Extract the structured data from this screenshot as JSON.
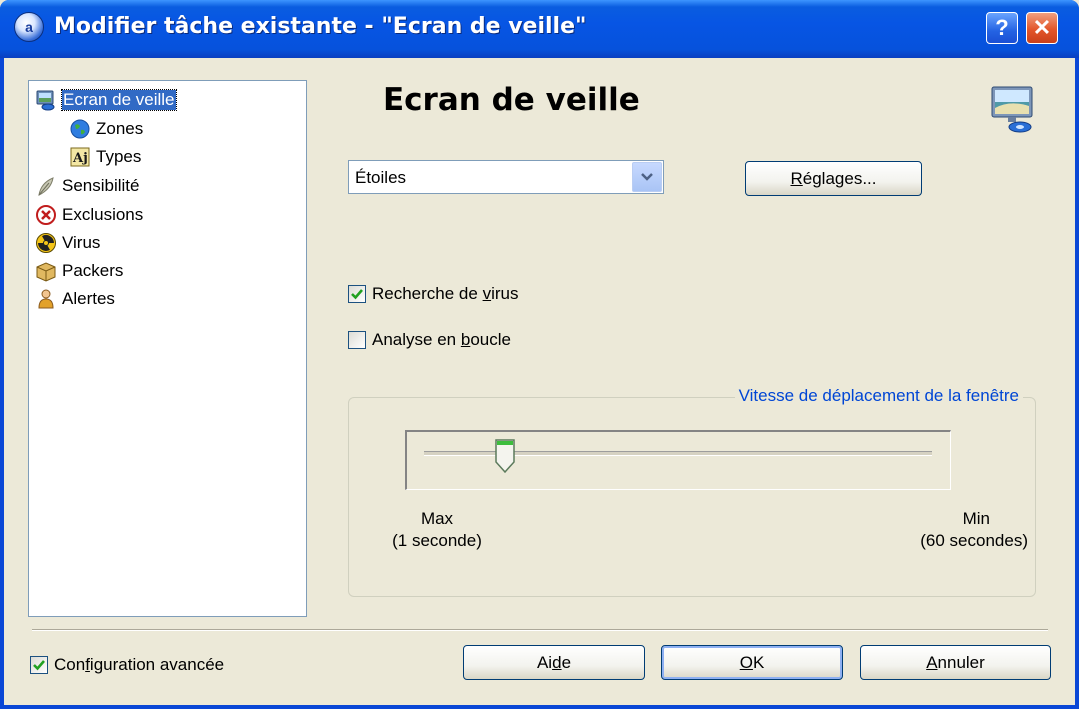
{
  "window": {
    "title": "Modifier tâche existante - \"Ecran de veille\"",
    "help_glyph": "?",
    "close_glyph": "✕"
  },
  "tree": {
    "items": [
      {
        "label": "Ecran de veille",
        "icon": "monitor-icon",
        "selected": true
      },
      {
        "label": "Zones",
        "icon": "globe-icon"
      },
      {
        "label": "Types",
        "icon": "types-icon"
      },
      {
        "label": "Sensibilité",
        "icon": "feather-icon"
      },
      {
        "label": "Exclusions",
        "icon": "exclusion-icon"
      },
      {
        "label": "Virus",
        "icon": "radiation-icon"
      },
      {
        "label": "Packers",
        "icon": "package-icon"
      },
      {
        "label": "Alertes",
        "icon": "person-icon"
      }
    ]
  },
  "main": {
    "title": "Ecran de veille",
    "combo_value": "Étoiles",
    "settings_button_prefix": "R",
    "settings_button_rest": "églages...",
    "settings_button_u": "R",
    "virus_check": {
      "pre": "Recherche de ",
      "u": "v",
      "post": "irus",
      "checked": true
    },
    "loop_check": {
      "pre": "Analyse en ",
      "u": "b",
      "post": "oucle",
      "checked": false
    },
    "speed_group": {
      "legend": "Vitesse de déplacement de la fenêtre",
      "max_label": "Max",
      "max_sub": "(1 seconde)",
      "min_label": "Min",
      "min_sub": "(60 secondes)",
      "slider_value_fraction": 0.16
    }
  },
  "footer": {
    "advanced_check": {
      "pre": "Con",
      "u": "f",
      "post": "iguration avancée",
      "checked": true
    },
    "help_button": {
      "pre": "Ai",
      "u": "d",
      "post": "e"
    },
    "ok_button": {
      "u": "O",
      "post": "K"
    },
    "cancel_button": {
      "u": "A",
      "post": "nnuler"
    }
  },
  "colors": {
    "title_bar": "#0652dc",
    "dialog_bg": "#ece9d8",
    "selection": "#316ac5",
    "group_legend": "#0046d5"
  }
}
